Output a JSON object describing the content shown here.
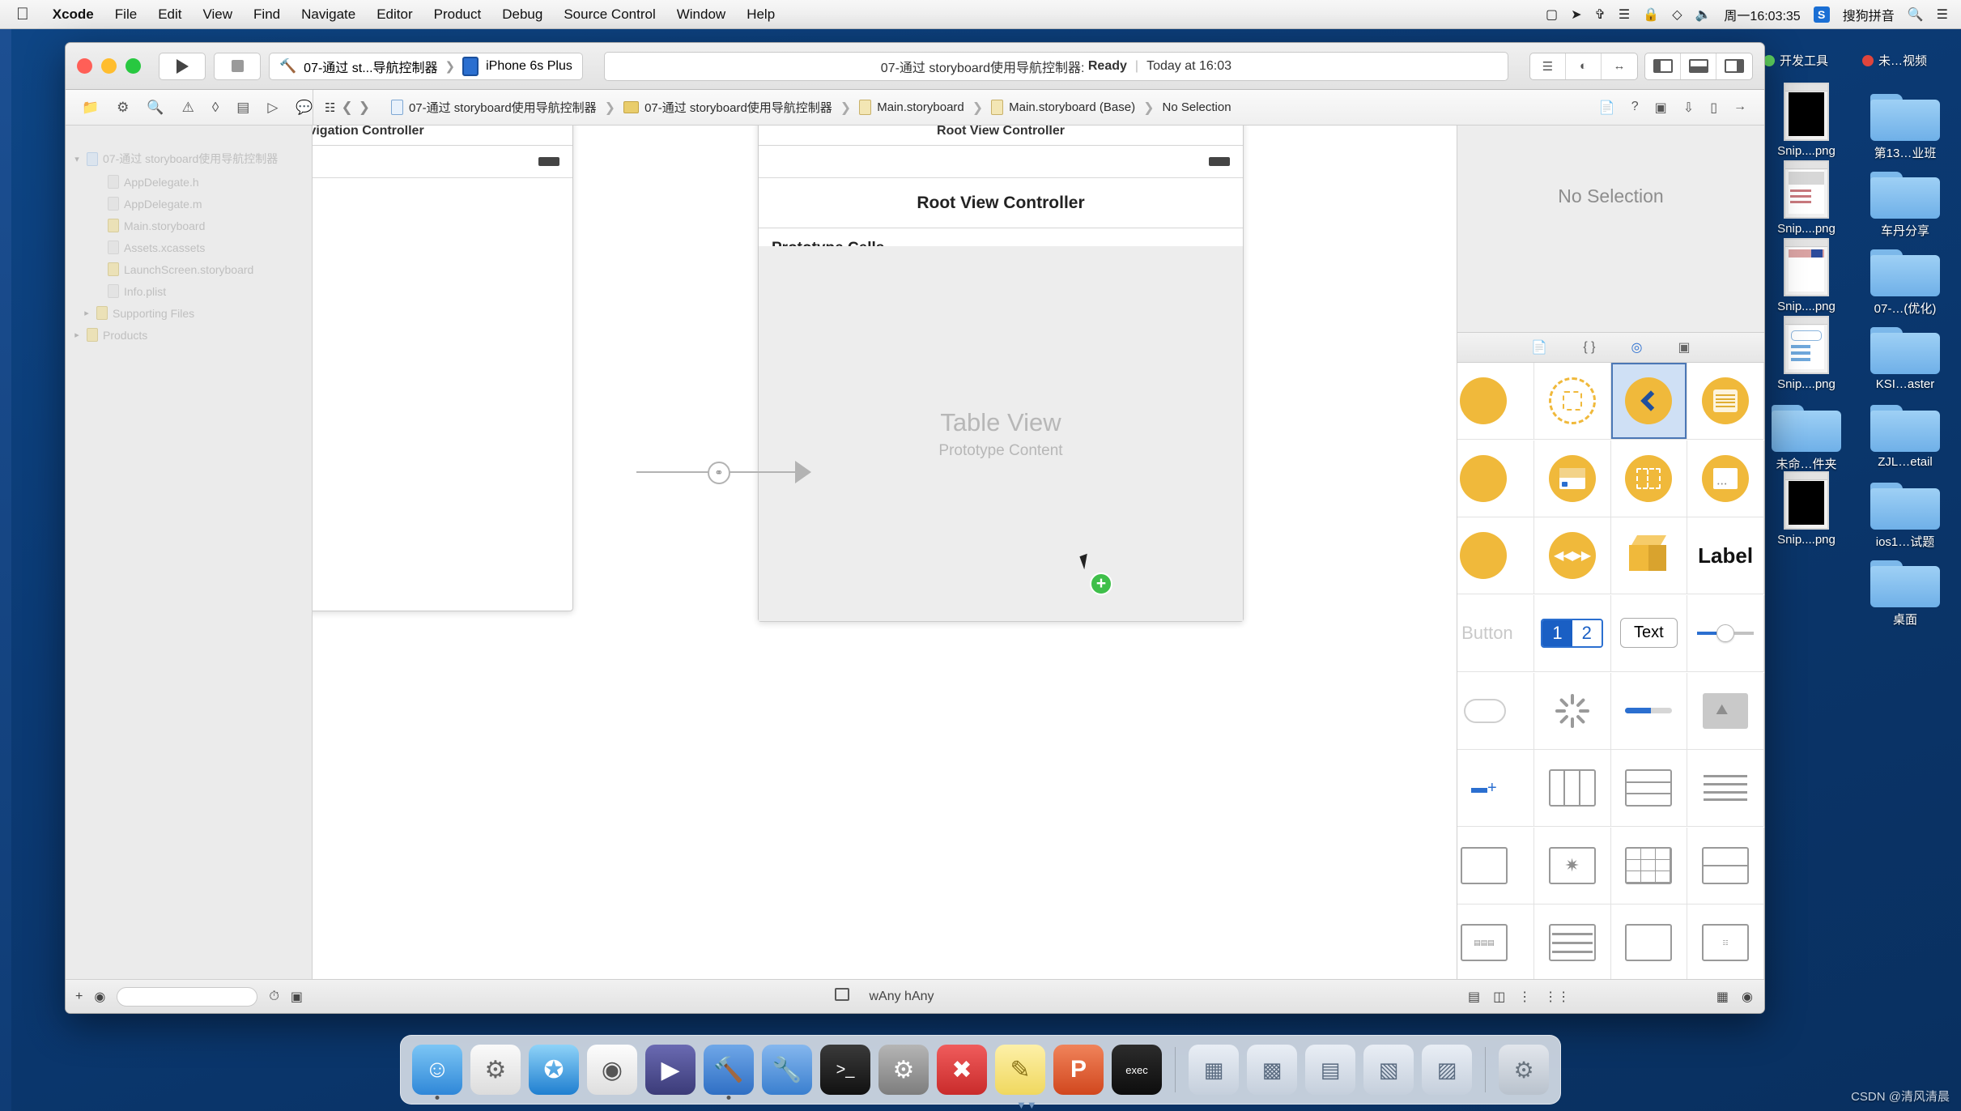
{
  "menubar": {
    "apple_icon": "apple-icon",
    "items": [
      {
        "label": "Xcode",
        "bold": true
      },
      {
        "label": "File",
        "bold": false
      },
      {
        "label": "Edit",
        "bold": false
      },
      {
        "label": "View",
        "bold": false
      },
      {
        "label": "Find",
        "bold": false
      },
      {
        "label": "Navigate",
        "bold": false
      },
      {
        "label": "Editor",
        "bold": false
      },
      {
        "label": "Product",
        "bold": false
      },
      {
        "label": "Debug",
        "bold": false
      },
      {
        "label": "Source Control",
        "bold": false
      },
      {
        "label": "Window",
        "bold": false
      },
      {
        "label": "Help",
        "bold": false
      }
    ],
    "status_icons": [
      "screen-record-icon",
      "location-icon",
      "bluetooth-icon",
      "airdrop-icon",
      "lock-icon",
      "shield-icon",
      "volume-icon"
    ],
    "clock": "周一16:03:35",
    "input_badge": "S",
    "input_method": "搜狗拼音",
    "search_icon": "search-icon",
    "list_icon": "notification-center-icon"
  },
  "xcode": {
    "toolbar": {
      "run_icon": "run-play-icon",
      "stop_icon": "stop-square-icon",
      "scheme": "07-通过 st...导航控制器",
      "scheme_sep": "❯",
      "destination": "iPhone 6s Plus",
      "status_project": "07-通过 storyboard使用导航控制器:",
      "status_state": "Ready",
      "status_sep": "|",
      "status_time": "Today at 16:03",
      "editor_segments": [
        "standard-editor-icon",
        "assistant-editor-icon",
        "version-editor-icon"
      ],
      "pane_segments": [
        "navigator-toggle-icon",
        "debug-area-toggle-icon",
        "utilities-toggle-icon"
      ]
    },
    "jumpbar": {
      "nav_icons": [
        "folder-navigator-icon",
        "source-control-navigator-icon",
        "search-navigator-icon",
        "issue-navigator-icon",
        "test-navigator-icon",
        "debug-navigator-icon",
        "breakpoint-navigator-icon",
        "report-navigator-icon"
      ],
      "back_icon": "back-chevron-icon",
      "forward_icon": "forward-chevron-icon",
      "related_icon": "related-items-icon",
      "crumbs": [
        {
          "label": "07-通过 storyboard使用导航控制器",
          "icon": "project-file-icon"
        },
        {
          "label": "07-通过 storyboard使用导航控制器",
          "icon": "folder-icon"
        },
        {
          "label": "Main.storyboard",
          "icon": "storyboard-file-icon"
        },
        {
          "label": "Main.storyboard (Base)",
          "icon": "storyboard-base-icon"
        },
        {
          "label": "No Selection",
          "icon": ""
        }
      ],
      "right_icons": [
        "page-icon",
        "help-icon",
        "minimap-icon",
        "download-icon",
        "device-icon",
        "hide-icon"
      ]
    },
    "navigator": {
      "tree": [
        {
          "label": "07-通过 storyboard使用导航控制器",
          "depth": 0,
          "icon": "project-file-icon",
          "tri": "▾"
        },
        {
          "label": "AppDelegate.h",
          "depth": 1,
          "icon": "header-file-icon",
          "tri": ""
        },
        {
          "label": "AppDelegate.m",
          "depth": 1,
          "icon": "source-file-icon",
          "tri": ""
        },
        {
          "label": "Main.storyboard",
          "depth": 1,
          "icon": "storyboard-file-icon",
          "tri": ""
        },
        {
          "label": "Assets.xcassets",
          "depth": 1,
          "icon": "assets-icon",
          "tri": ""
        },
        {
          "label": "LaunchScreen.storyboard",
          "depth": 1,
          "icon": "storyboard-file-icon",
          "tri": ""
        },
        {
          "label": "Info.plist",
          "depth": 1,
          "icon": "plist-file-icon",
          "tri": ""
        },
        {
          "label": "Supporting Files",
          "depth": 1,
          "icon": "folder-icon",
          "tri": "▸"
        },
        {
          "label": "Products",
          "depth": 0,
          "icon": "folder-icon",
          "tri": "▸"
        }
      ],
      "footer": {
        "add_icon": "add-plus-icon",
        "filter_icon": "filter-icon",
        "placeholder": ""
      }
    },
    "canvas": {
      "nav_scene": {
        "title": "Navigation Controller",
        "battery_icon": "battery-icon"
      },
      "root_scene": {
        "header": "Root View Controller",
        "title": "Root View Controller",
        "battery_icon": "battery-icon",
        "prototype_cells_label": "Prototype Cells",
        "tableview_title": "Table View",
        "tableview_subtitle": "Prototype Content"
      },
      "segue": {
        "icon": "relationship-segue-icon",
        "arrow": "segue-arrow-icon"
      },
      "cursor": {
        "pointer": "mouse-pointer-icon",
        "badge": "add-drop-badge-icon"
      }
    },
    "utility": {
      "inspector_placeholder": "No Selection",
      "library_tabs": [
        {
          "icon": "file-template-library-icon",
          "active": false
        },
        {
          "icon": "code-snippet-library-icon",
          "active": false
        },
        {
          "icon": "object-library-icon",
          "active": true
        },
        {
          "icon": "media-library-icon",
          "active": false
        }
      ],
      "objects": [
        [
          {
            "kind": "circle-partial",
            "name": "view-controller-object"
          },
          {
            "kind": "dashed-circle",
            "name": "container-view-object"
          },
          {
            "kind": "back-chevron",
            "name": "navigation-controller-object",
            "selected": true
          },
          {
            "kind": "lines-circle",
            "name": "table-view-controller-object"
          }
        ],
        [
          {
            "kind": "circle-partial",
            "name": "tab-bar-controller-object"
          },
          {
            "kind": "navbox",
            "name": "navigation-item-object"
          },
          {
            "kind": "split",
            "name": "split-view-controller-object"
          },
          {
            "kind": "pagebox",
            "name": "page-view-controller-object"
          }
        ],
        [
          {
            "kind": "circle-partial",
            "name": "collection-view-controller-object"
          },
          {
            "kind": "player",
            "name": "avplayer-controller-object"
          },
          {
            "kind": "cube",
            "name": "scene-kit-view-object"
          },
          {
            "kind": "label",
            "label": "Label",
            "name": "label-object"
          }
        ],
        [
          {
            "kind": "button-faded",
            "label": "Button",
            "name": "button-object"
          },
          {
            "kind": "segmented",
            "label_a": "1",
            "label_b": "2",
            "name": "segmented-control-object"
          },
          {
            "kind": "textfield",
            "label": "Text",
            "name": "text-field-object"
          },
          {
            "kind": "slider",
            "name": "slider-object"
          }
        ],
        [
          {
            "kind": "switch",
            "name": "switch-object"
          },
          {
            "kind": "spinner",
            "name": "activity-indicator-object"
          },
          {
            "kind": "progbar",
            "name": "progress-view-object"
          },
          {
            "kind": "graybox",
            "name": "image-view-object"
          }
        ],
        [
          {
            "kind": "stepper",
            "name": "stepper-object"
          },
          {
            "kind": "wire-cols",
            "name": "stack-view-horizontal-object"
          },
          {
            "kind": "wire-rows",
            "name": "table-view-object"
          },
          {
            "kind": "wire-lines",
            "name": "table-view-cell-object"
          }
        ],
        [
          {
            "kind": "wire-plain",
            "name": "text-view-object"
          },
          {
            "kind": "wire-star",
            "name": "scroll-view-object"
          },
          {
            "kind": "wire-grid",
            "name": "collection-view-object"
          },
          {
            "kind": "wire-rows2",
            "name": "collection-view-cell-object"
          }
        ],
        [
          {
            "kind": "wire-calc",
            "name": "toolbar-object"
          },
          {
            "kind": "wire-rows3",
            "name": "search-bar-object"
          },
          {
            "kind": "wire-plain2",
            "name": "view-object"
          },
          {
            "kind": "wire-cal",
            "name": "date-picker-object"
          }
        ]
      ],
      "footer": {
        "grid_icon": "library-grid-icon",
        "search_icon": "library-search-icon",
        "placeholder": ""
      }
    },
    "footer": {
      "add_icon": "add-constraint-icon",
      "filter_icon": "filter-icon",
      "panel_icon": "document-outline-icon",
      "size_class": "wAny hAny",
      "size_prefix_w": "w",
      "size_prefix_h": "h",
      "right_icons": [
        "align-icon",
        "pin-icon",
        "resolve-issues-icon",
        "embed-icon"
      ],
      "zoom_icons": [
        "zoom-out-icon",
        "zoom-in-icon"
      ]
    }
  },
  "desktop": {
    "tags": [
      {
        "label": "开发工具",
        "color": "#5fd35f"
      },
      {
        "label": "未…视频",
        "color": "#e0453c"
      }
    ],
    "icons": [
      {
        "label": "Snip....png",
        "type": "png-black"
      },
      {
        "label": "第13…业班",
        "type": "folder"
      },
      {
        "label": "Snip....png",
        "type": "png-a"
      },
      {
        "label": "车丹分享",
        "type": "folder"
      },
      {
        "label": "Snip....png",
        "type": "png-b"
      },
      {
        "label": "07-…(优化)",
        "type": "folder"
      },
      {
        "label": "Snip....png",
        "type": "png-c"
      },
      {
        "label": "KSI…aster",
        "type": "folder"
      },
      {
        "label": "未命…件夹",
        "type": "folder"
      },
      {
        "label": "ZJL…etail",
        "type": "folder"
      },
      {
        "label": "Snip....png",
        "type": "png-black"
      },
      {
        "label": "ios1…试题",
        "type": "folder"
      },
      {
        "label": "桌面",
        "type": "folder"
      }
    ]
  },
  "dock": {
    "apps": [
      {
        "name": "finder-icon",
        "glyph": "☺",
        "color": "#3a93e8",
        "running": true
      },
      {
        "name": "launchpad-icon",
        "glyph": "🚀",
        "color": "#e5e5e5",
        "running": false
      },
      {
        "name": "safari-icon",
        "glyph": "🧭",
        "color": "#2e9bf0",
        "running": false
      },
      {
        "name": "mouse-app-icon",
        "glyph": "🖱",
        "color": "#f0f0f0",
        "running": false
      },
      {
        "name": "quicktime-icon",
        "glyph": "🎬",
        "color": "#4a4a8c",
        "running": false
      },
      {
        "name": "xcode-icon",
        "glyph": "🔨",
        "color": "#3d7fd6",
        "running": true
      },
      {
        "name": "xcode-beta-icon",
        "glyph": "🔧",
        "color": "#4f8fe0",
        "running": false
      },
      {
        "name": "terminal-icon",
        "glyph": ">_",
        "color": "#242424",
        "running": false
      },
      {
        "name": "system-preferences-icon",
        "glyph": "⚙",
        "color": "#8c8c8c",
        "running": false
      },
      {
        "name": "xmind-icon",
        "glyph": "✕",
        "color": "#e03b3b",
        "running": false
      },
      {
        "name": "notes-icon",
        "glyph": "📝",
        "color": "#f7e08a",
        "running": false
      },
      {
        "name": "keynote-icon",
        "glyph": "P",
        "color": "#e05a2b",
        "running": false
      },
      {
        "name": "iterm-icon",
        "glyph": "exec",
        "color": "#1e1e1e",
        "running": false
      }
    ],
    "recents": [
      {
        "name": "recent-window-1",
        "glyph": "▤"
      },
      {
        "name": "recent-window-2",
        "glyph": "▥"
      },
      {
        "name": "recent-window-3",
        "glyph": "▦"
      },
      {
        "name": "recent-window-4",
        "glyph": "▧"
      },
      {
        "name": "recent-window-5",
        "glyph": "▨"
      }
    ],
    "trash": {
      "name": "trash-icon",
      "glyph": "🗑"
    }
  },
  "watermark": "CSDN @清风清晨"
}
